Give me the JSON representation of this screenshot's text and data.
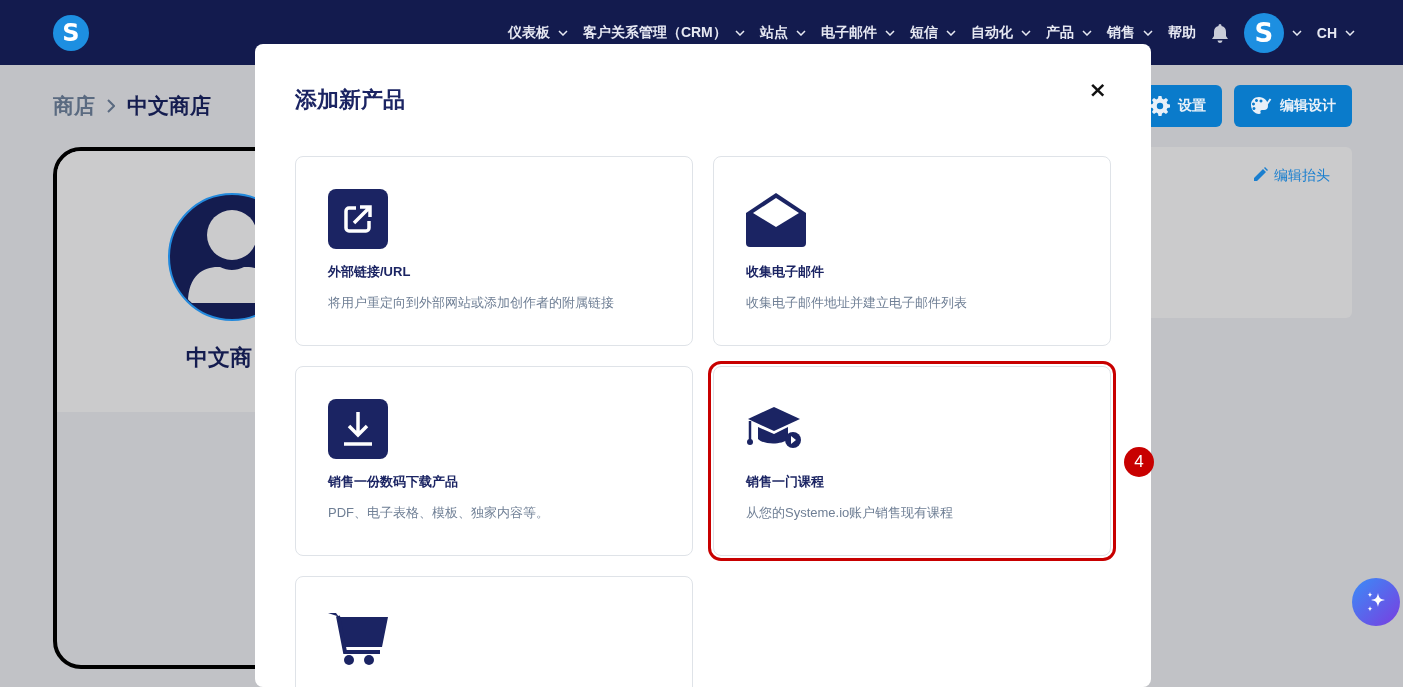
{
  "header": {
    "logo": "S",
    "nav": [
      {
        "label": "仪表板",
        "dropdown": true
      },
      {
        "label": "客户关系管理（CRM）",
        "dropdown": true
      },
      {
        "label": "站点",
        "dropdown": true
      },
      {
        "label": "电子邮件",
        "dropdown": true
      },
      {
        "label": "短信",
        "dropdown": true
      },
      {
        "label": "自动化",
        "dropdown": true
      },
      {
        "label": "产品",
        "dropdown": true
      },
      {
        "label": "销售",
        "dropdown": true
      },
      {
        "label": "帮助",
        "dropdown": false
      }
    ],
    "avatar": "S",
    "account": "CH"
  },
  "breadcrumb": {
    "parent": "商店",
    "current": "中文商店"
  },
  "toolbar_buttons": [
    "设置",
    "编辑设计"
  ],
  "store_card": {
    "name": "中文商"
  },
  "header_panel": {
    "edit_link": "编辑抬头"
  },
  "modal": {
    "title": "添加新产品",
    "close": "×",
    "options": [
      {
        "title": "外部链接/URL",
        "description": "将用户重定向到外部网站或添加创作者的附属链接",
        "highlighted": false
      },
      {
        "title": "收集电子邮件",
        "description": "收集电子邮件地址并建立电子邮件列表",
        "highlighted": false
      },
      {
        "title": "销售一份数码下载产品",
        "description": "PDF、电子表格、模板、独家内容等。",
        "highlighted": false
      },
      {
        "title": "销售一门课程",
        "description": "从您的Systeme.io账户销售现有课程",
        "highlighted": true
      },
      {
        "highlighted": false
      }
    ]
  },
  "callout": {
    "label": "4"
  }
}
